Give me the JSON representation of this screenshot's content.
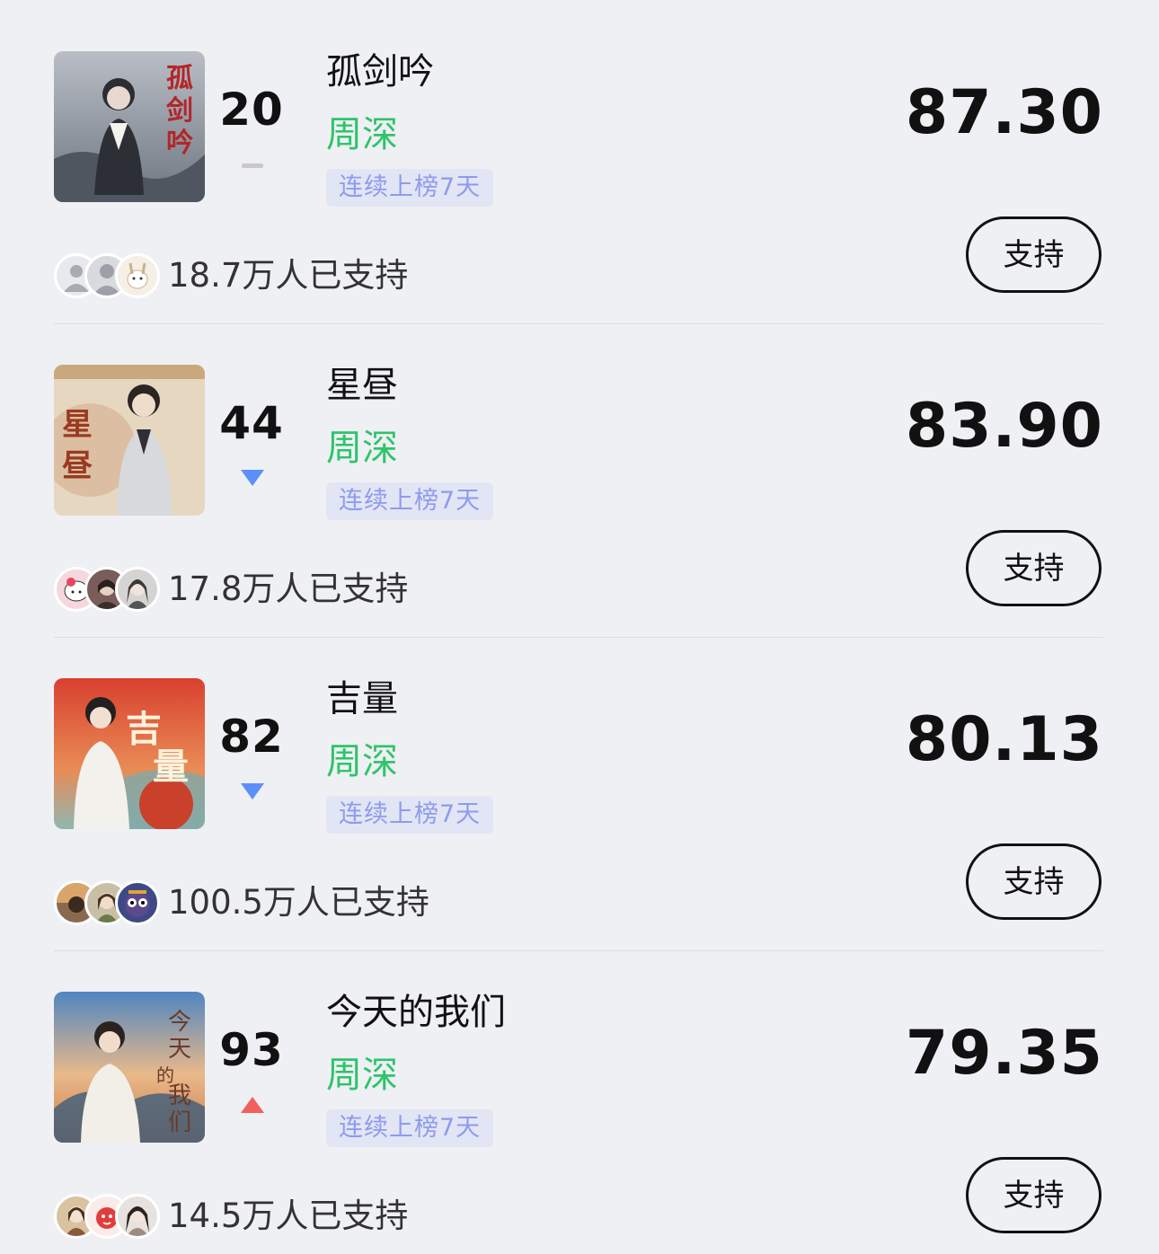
{
  "colors": {
    "artist": "#2ec46a",
    "trend_down": "#5b8ff9",
    "trend_up": "#f25f5c",
    "trend_same": "#c8c8cc",
    "streak_text": "#8d9bef",
    "streak_bg": "#e2e5f3"
  },
  "items": [
    {
      "rank": "20",
      "trend": "same",
      "trend_icon": "dash-icon",
      "title": "孤剑吟",
      "artist": "周深",
      "streak": "连续上榜7天",
      "score": "87.30",
      "supporters": "18.7万人已支持",
      "support_label": "支持",
      "cover_text": "孤剑吟"
    },
    {
      "rank": "44",
      "trend": "down",
      "trend_icon": "triangle-down-icon",
      "title": "星昼",
      "artist": "周深",
      "streak": "连续上榜7天",
      "score": "83.90",
      "supporters": "17.8万人已支持",
      "support_label": "支持",
      "cover_text": "星昼"
    },
    {
      "rank": "82",
      "trend": "down",
      "trend_icon": "triangle-down-icon",
      "title": "吉量",
      "artist": "周深",
      "streak": "连续上榜7天",
      "score": "80.13",
      "supporters": "100.5万人已支持",
      "support_label": "支持",
      "cover_text": "吉量"
    },
    {
      "rank": "93",
      "trend": "up",
      "trend_icon": "triangle-up-icon",
      "title": "今天的我们",
      "artist": "周深",
      "streak": "连续上榜7天",
      "score": "79.35",
      "supporters": "14.5万人已支持",
      "support_label": "支持",
      "cover_text": "今天的我们"
    }
  ]
}
